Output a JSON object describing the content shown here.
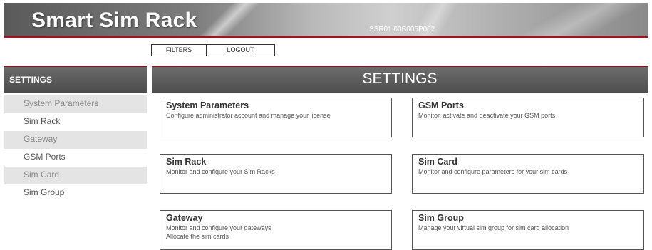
{
  "header": {
    "app_title": "Smart Sim Rack",
    "device_id": "SSR01.00B005P002"
  },
  "topbar": {
    "filters_label": "FILTERS",
    "logout_label": "LOGOUT"
  },
  "sidebar": {
    "title": "SETTINGS",
    "items": [
      {
        "label": "System Parameters"
      },
      {
        "label": "Sim Rack"
      },
      {
        "label": "Gateway"
      },
      {
        "label": "GSM Ports"
      },
      {
        "label": "Sim Card"
      },
      {
        "label": "Sim Group"
      }
    ]
  },
  "main": {
    "title": "SETTINGS",
    "cards": [
      {
        "title": "System Parameters",
        "desc": [
          "Configure administrator account and manage your license"
        ]
      },
      {
        "title": "GSM Ports",
        "desc": [
          "Monitor, activate and deactivate your GSM ports"
        ]
      },
      {
        "title": "Sim Rack",
        "desc": [
          "Monitor and configure your Sim Racks"
        ]
      },
      {
        "title": "Sim Card",
        "desc": [
          "Monitor and configure parameters for your sim cards"
        ]
      },
      {
        "title": "Gateway",
        "desc": [
          "Monitor and configure your gateways",
          "Allocate the sim cards"
        ]
      },
      {
        "title": "Sim Group",
        "desc": [
          "Manage your virtual sim group for sim card allocation"
        ]
      }
    ]
  },
  "colors": {
    "accent_red": "#8b1c2a",
    "header_gray": "#5a5a5a"
  }
}
